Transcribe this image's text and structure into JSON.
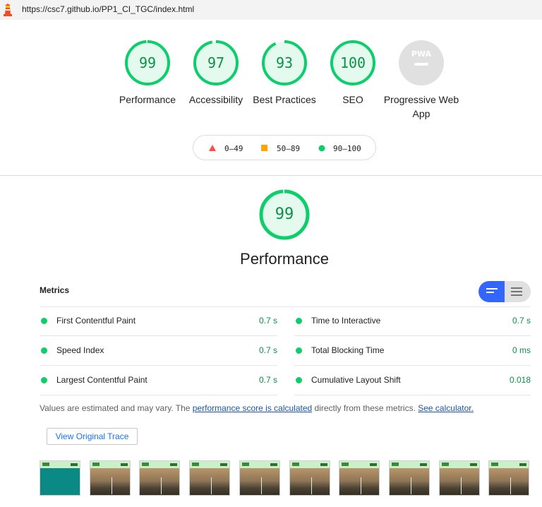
{
  "browser": {
    "url": "https://csc7.github.io/PP1_CI_TGC/index.html",
    "icon": "lighthouse-icon"
  },
  "summary": {
    "gauges": [
      {
        "score": "99",
        "value": 99,
        "label": "Performance"
      },
      {
        "score": "97",
        "value": 97,
        "label": "Accessibility"
      },
      {
        "score": "93",
        "value": 93,
        "label": "Best Practices"
      },
      {
        "score": "100",
        "value": 100,
        "label": "SEO"
      }
    ],
    "pwa": {
      "badge": "PWA",
      "label": "Progressive Web App"
    },
    "legend": [
      {
        "range": "0–49",
        "color": "#ff4e42",
        "shape": "triangle"
      },
      {
        "range": "50–89",
        "color": "#ffa400",
        "shape": "square"
      },
      {
        "range": "90–100",
        "color": "#0cce6b",
        "shape": "circle"
      }
    ]
  },
  "category": {
    "score": "99",
    "value": 99,
    "title": "Performance",
    "metrics_heading": "Metrics",
    "metrics": [
      {
        "label": "First Contentful Paint",
        "value": "0.7 s"
      },
      {
        "label": "Time to Interactive",
        "value": "0.7 s"
      },
      {
        "label": "Speed Index",
        "value": "0.7 s"
      },
      {
        "label": "Total Blocking Time",
        "value": "0 ms"
      },
      {
        "label": "Largest Contentful Paint",
        "value": "0.7 s"
      },
      {
        "label": "Cumulative Layout Shift",
        "value": "0.018"
      }
    ],
    "note_prefix": "Values are estimated and may vary. The ",
    "note_link1": "performance score is calculated",
    "note_middle": " directly from these metrics. ",
    "note_link2": "See calculator.",
    "trace_button": "View Original Trace",
    "filmstrip_frames": 10
  },
  "colors": {
    "pass": "#0cce6b",
    "pass_text": "#0c9048",
    "accent": "#3366ff"
  }
}
